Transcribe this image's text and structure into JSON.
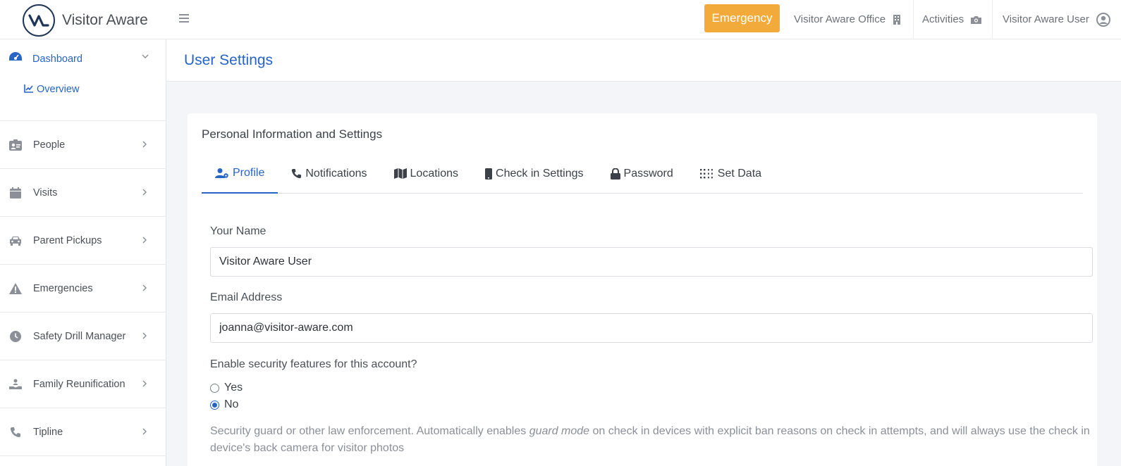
{
  "app": {
    "name": "Visitor Aware"
  },
  "topbar": {
    "emergency_label": "Emergency",
    "office_label": "Visitor Aware Office",
    "activities_label": "Activities",
    "user_label": "Visitor Aware User"
  },
  "sidebar": {
    "dashboard": {
      "label": "Dashboard",
      "children": [
        {
          "label": "Overview"
        }
      ]
    },
    "items": [
      {
        "label": "People",
        "icon": "id-badge-icon"
      },
      {
        "label": "Visits",
        "icon": "calendar-icon"
      },
      {
        "label": "Parent Pickups",
        "icon": "car-icon"
      },
      {
        "label": "Emergencies",
        "icon": "warning-icon"
      },
      {
        "label": "Safety Drill Manager",
        "icon": "clock-icon"
      },
      {
        "label": "Family Reunification",
        "icon": "hand-holding-person-icon"
      },
      {
        "label": "Tipline",
        "icon": "phone-icon"
      }
    ]
  },
  "page": {
    "title": "User Settings"
  },
  "card": {
    "title": "Personal Information and Settings",
    "tabs": [
      {
        "label": "Profile",
        "active": true
      },
      {
        "label": "Notifications"
      },
      {
        "label": "Locations"
      },
      {
        "label": "Check in Settings"
      },
      {
        "label": "Password"
      },
      {
        "label": "Set Data"
      }
    ],
    "form": {
      "name_label": "Your Name",
      "name_value": "Visitor Aware User",
      "email_label": "Email Address",
      "email_value": "joanna@visitor-aware.com",
      "security_question": "Enable security features for this account?",
      "options": [
        {
          "label": "Yes",
          "checked": false
        },
        {
          "label": "No",
          "checked": true
        }
      ],
      "help_before": "Security guard or other law enforcement. Automatically enables ",
      "help_em": "guard mode",
      "help_after": " on check in devices with explicit ban reasons on check in attempts, and will always use the check in device's back camera for visitor photos"
    }
  },
  "colors": {
    "accent": "#2764c5",
    "emergency": "#f2aa3b",
    "brand_dark": "#1f3556"
  }
}
